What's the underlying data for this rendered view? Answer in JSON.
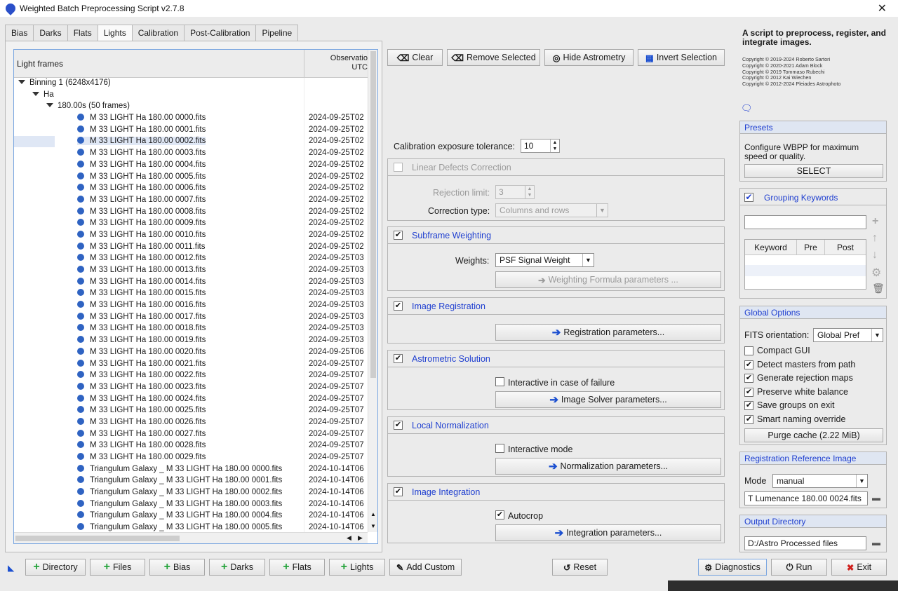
{
  "window": {
    "title": "Weighted Batch Preprocessing Script v2.7.8",
    "close": "✕"
  },
  "tabs": [
    "Bias",
    "Darks",
    "Flats",
    "Lights",
    "Calibration",
    "Post-Calibration",
    "Pipeline"
  ],
  "active_tab": "Lights",
  "tree": {
    "col1": "Light frames",
    "col2": "Observatio UTC",
    "col2_line1": "Observatio",
    "col2_line2": "UTC",
    "binning": "Binning 1 (6248x4176)",
    "filter": "Ha",
    "exposure": "180.00s (50 frames)",
    "files": [
      {
        "name": "M 33 LIGHT Ha 180.00 0000.fits",
        "date": "2024-09-25T02"
      },
      {
        "name": "M 33 LIGHT Ha 180.00 0001.fits",
        "date": "2024-09-25T02"
      },
      {
        "name": "M 33 LIGHT Ha 180.00 0002.fits",
        "date": "2024-09-25T02"
      },
      {
        "name": "M 33 LIGHT Ha 180.00 0003.fits",
        "date": "2024-09-25T02"
      },
      {
        "name": "M 33 LIGHT Ha 180.00 0004.fits",
        "date": "2024-09-25T02"
      },
      {
        "name": "M 33 LIGHT Ha 180.00 0005.fits",
        "date": "2024-09-25T02"
      },
      {
        "name": "M 33 LIGHT Ha 180.00 0006.fits",
        "date": "2024-09-25T02"
      },
      {
        "name": "M 33 LIGHT Ha 180.00 0007.fits",
        "date": "2024-09-25T02"
      },
      {
        "name": "M 33 LIGHT Ha 180.00 0008.fits",
        "date": "2024-09-25T02"
      },
      {
        "name": "M 33 LIGHT Ha 180.00 0009.fits",
        "date": "2024-09-25T02"
      },
      {
        "name": "M 33 LIGHT Ha 180.00 0010.fits",
        "date": "2024-09-25T02"
      },
      {
        "name": "M 33 LIGHT Ha 180.00 0011.fits",
        "date": "2024-09-25T02"
      },
      {
        "name": "M 33 LIGHT Ha 180.00 0012.fits",
        "date": "2024-09-25T03"
      },
      {
        "name": "M 33 LIGHT Ha 180.00 0013.fits",
        "date": "2024-09-25T03"
      },
      {
        "name": "M 33 LIGHT Ha 180.00 0014.fits",
        "date": "2024-09-25T03"
      },
      {
        "name": "M 33 LIGHT Ha 180.00 0015.fits",
        "date": "2024-09-25T03"
      },
      {
        "name": "M 33 LIGHT Ha 180.00 0016.fits",
        "date": "2024-09-25T03"
      },
      {
        "name": "M 33 LIGHT Ha 180.00 0017.fits",
        "date": "2024-09-25T03"
      },
      {
        "name": "M 33 LIGHT Ha 180.00 0018.fits",
        "date": "2024-09-25T03"
      },
      {
        "name": "M 33 LIGHT Ha 180.00 0019.fits",
        "date": "2024-09-25T03"
      },
      {
        "name": "M 33 LIGHT Ha 180.00 0020.fits",
        "date": "2024-09-25T06"
      },
      {
        "name": "M 33 LIGHT Ha 180.00 0021.fits",
        "date": "2024-09-25T07"
      },
      {
        "name": "M 33 LIGHT Ha 180.00 0022.fits",
        "date": "2024-09-25T07"
      },
      {
        "name": "M 33 LIGHT Ha 180.00 0023.fits",
        "date": "2024-09-25T07"
      },
      {
        "name": "M 33 LIGHT Ha 180.00 0024.fits",
        "date": "2024-09-25T07"
      },
      {
        "name": "M 33 LIGHT Ha 180.00 0025.fits",
        "date": "2024-09-25T07"
      },
      {
        "name": "M 33 LIGHT Ha 180.00 0026.fits",
        "date": "2024-09-25T07"
      },
      {
        "name": "M 33 LIGHT Ha 180.00 0027.fits",
        "date": "2024-09-25T07"
      },
      {
        "name": "M 33 LIGHT Ha 180.00 0028.fits",
        "date": "2024-09-25T07"
      },
      {
        "name": "M 33 LIGHT Ha 180.00 0029.fits",
        "date": "2024-09-25T07"
      },
      {
        "name": "Triangulum Galaxy _ M 33 LIGHT Ha 180.00 0000.fits",
        "date": "2024-10-14T06"
      },
      {
        "name": "Triangulum Galaxy _ M 33 LIGHT Ha 180.00 0001.fits",
        "date": "2024-10-14T06"
      },
      {
        "name": "Triangulum Galaxy _ M 33 LIGHT Ha 180.00 0002.fits",
        "date": "2024-10-14T06"
      },
      {
        "name": "Triangulum Galaxy _ M 33 LIGHT Ha 180.00 0003.fits",
        "date": "2024-10-14T06"
      },
      {
        "name": "Triangulum Galaxy _ M 33 LIGHT Ha 180.00 0004.fits",
        "date": "2024-10-14T06"
      },
      {
        "name": "Triangulum Galaxy _ M 33 LIGHT Ha 180.00 0005.fits",
        "date": "2024-10-14T06"
      }
    ],
    "selected_index": 2
  },
  "toolbar": {
    "clear": "Clear",
    "remove_selected": "Remove Selected",
    "hide_astrometry": "Hide Astrometry",
    "invert_selection": "Invert Selection"
  },
  "calibration_tolerance": {
    "label": "Calibration exposure tolerance:",
    "value": "10"
  },
  "linear_defects": {
    "title": "Linear Defects Correction",
    "checked": false,
    "rejection_label": "Rejection limit:",
    "rejection_value": "3",
    "correction_label": "Correction type:",
    "correction_value": "Columns and rows"
  },
  "subframe_weighting": {
    "title": "Subframe Weighting",
    "checked": true,
    "weights_label": "Weights:",
    "weights_value": "PSF Signal Weight",
    "formula_button": "Weighting Formula parameters ..."
  },
  "image_registration": {
    "title": "Image Registration",
    "checked": true,
    "button": "Registration parameters..."
  },
  "astrometric_solution": {
    "title": "Astrometric Solution",
    "checked": true,
    "interactive_label": "Interactive in case of failure",
    "interactive_checked": false,
    "button": "Image Solver parameters..."
  },
  "local_normalization": {
    "title": "Local Normalization",
    "checked": true,
    "interactive_label": "Interactive mode",
    "interactive_checked": false,
    "button": "Normalization parameters..."
  },
  "image_integration": {
    "title": "Image Integration",
    "checked": true,
    "autocrop_label": "Autocrop",
    "autocrop_checked": true,
    "button": "Integration parameters..."
  },
  "right": {
    "title": "A script to preprocess, register, and integrate images.",
    "copyright": [
      "Copyright © 2019-2024 Roberto Sartori",
      "Copyright © 2020-2021 Adam Block",
      "Copyright © 2019 Tommaso Rubechi",
      "Copyright © 2012 Kai Wiechen",
      "Copyright © 2012-2024 Pleiades Astrophoto"
    ],
    "presets": {
      "title": "Presets",
      "text": "Configure WBPP for maximum speed or quality.",
      "button": "SELECT"
    },
    "grouping": {
      "title": "Grouping Keywords",
      "checked": true,
      "input": "",
      "cols": [
        "Keyword",
        "Pre",
        "Post"
      ]
    },
    "global": {
      "title": "Global Options",
      "fits_label": "FITS orientation:",
      "fits_value": "Global Pref",
      "options": [
        {
          "label": "Compact GUI",
          "checked": false
        },
        {
          "label": "Detect masters from path",
          "checked": true
        },
        {
          "label": "Generate rejection maps",
          "checked": true
        },
        {
          "label": "Preserve white balance",
          "checked": true
        },
        {
          "label": "Save groups on exit",
          "checked": true
        },
        {
          "label": "Smart naming override",
          "checked": true
        }
      ],
      "purge": "Purge cache (2.22 MiB)"
    },
    "reference": {
      "title": "Registration Reference Image",
      "mode_label": "Mode",
      "mode_value": "manual",
      "file": "T Lumenance 180.00 0024.fits"
    },
    "output": {
      "title": "Output Directory",
      "path": "D:/Astro Processed files"
    }
  },
  "bottom": {
    "directory": "Directory",
    "files": "Files",
    "bias": "Bias",
    "darks": "Darks",
    "flats": "Flats",
    "lights": "Lights",
    "add_custom": "Add Custom",
    "reset": "Reset",
    "diagnostics": "Diagnostics",
    "run": "Run",
    "exit": "Exit"
  },
  "colors": {
    "accent": "#1f3fd0",
    "dot": "#2f63c2",
    "add": "#23a33a",
    "exit": "#d0211e"
  }
}
